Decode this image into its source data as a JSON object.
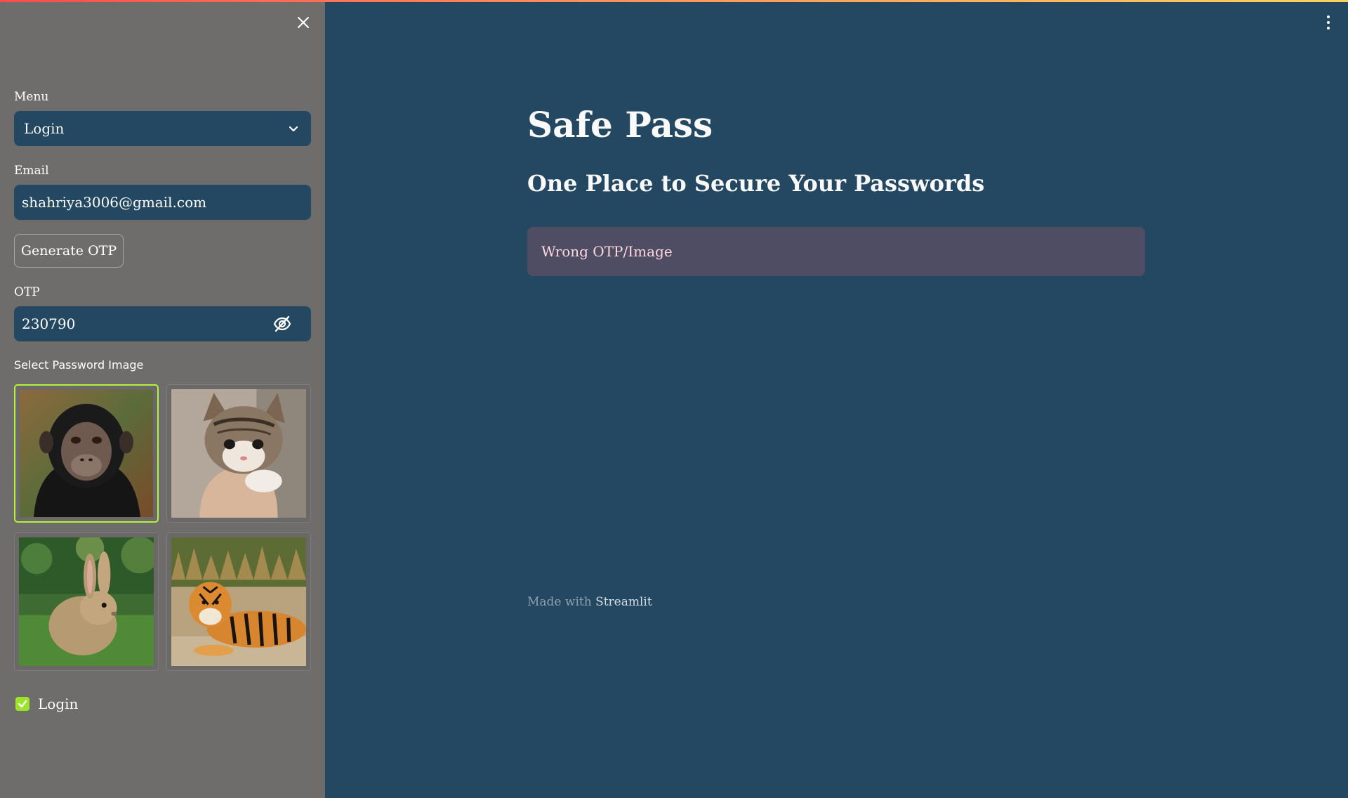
{
  "sidebar": {
    "menu_label": "Menu",
    "menu_selected": "Login",
    "email_label": "Email",
    "email_value": "shahriya3006@gmail.com",
    "generate_button": "Generate OTP",
    "otp_label": "OTP",
    "otp_value": "230790",
    "image_label": "Select Password Image",
    "images": [
      {
        "name": "chimpanzee",
        "selected": true
      },
      {
        "name": "kitten",
        "selected": false
      },
      {
        "name": "rabbit",
        "selected": false
      },
      {
        "name": "tiger",
        "selected": false
      }
    ],
    "login_checkbox_label": "Login",
    "login_checked": true
  },
  "main": {
    "title": "Safe Pass",
    "subtitle": "One Place to Secure Your Passwords",
    "alert_text": "Wrong OTP/Image",
    "footer_prefix": "Made with",
    "footer_brand": "Streamlit"
  },
  "icons": {
    "close": "close-icon",
    "dropdown": "chevron-down-icon",
    "visibility": "eye-off-icon",
    "menu": "vertical-dots-icon",
    "check": "check-icon"
  },
  "colors": {
    "main_background": "#244862",
    "sidebar_background": "#6e6d6b",
    "alert_background": "#4f4d63",
    "alert_text": "#ffd8df",
    "accent_green": "#9be22b",
    "selected_border": "#b5f23a"
  }
}
